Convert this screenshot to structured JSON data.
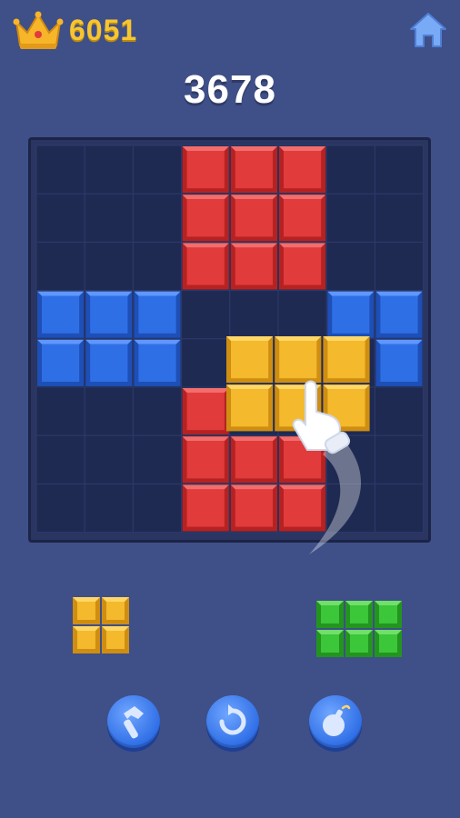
{
  "header": {
    "best_score": "6051",
    "best_icon": "crown-icon",
    "home_icon": "home-icon"
  },
  "score": "3678",
  "colors": {
    "background": "#3f4f88",
    "board": "#2a3561",
    "red": "#e23b3b",
    "blue": "#2f6fe6",
    "yellow": "#f4b92c",
    "green": "#3cc63a",
    "gold_text": "#f7c531"
  },
  "board": {
    "size": 8,
    "placed": [
      {
        "color": "red",
        "cells": [
          [
            0,
            3
          ],
          [
            0,
            4
          ],
          [
            0,
            5
          ],
          [
            1,
            3
          ],
          [
            1,
            4
          ],
          [
            1,
            5
          ],
          [
            2,
            3
          ],
          [
            2,
            4
          ],
          [
            2,
            5
          ]
        ]
      },
      {
        "color": "blue",
        "cells": [
          [
            3,
            0
          ],
          [
            3,
            1
          ],
          [
            3,
            2
          ],
          [
            4,
            0
          ],
          [
            4,
            1
          ],
          [
            4,
            2
          ]
        ]
      },
      {
        "color": "blue",
        "cells": [
          [
            3,
            6
          ],
          [
            3,
            7
          ],
          [
            4,
            7
          ]
        ]
      },
      {
        "color": "red",
        "cells": [
          [
            5,
            3
          ],
          [
            6,
            3
          ],
          [
            6,
            4
          ],
          [
            6,
            5
          ],
          [
            7,
            3
          ],
          [
            7,
            4
          ],
          [
            7,
            5
          ]
        ]
      }
    ],
    "dragging_piece": {
      "color": "yellow",
      "rows": 2,
      "cols": 3
    }
  },
  "tray": [
    {
      "color": "yellow",
      "rows": 2,
      "cols": 2
    },
    {
      "color": "green",
      "rows": 2,
      "cols": 3
    }
  ],
  "powerups": [
    {
      "name": "hammer-icon"
    },
    {
      "name": "rotate-icon"
    },
    {
      "name": "bomb-icon"
    }
  ]
}
